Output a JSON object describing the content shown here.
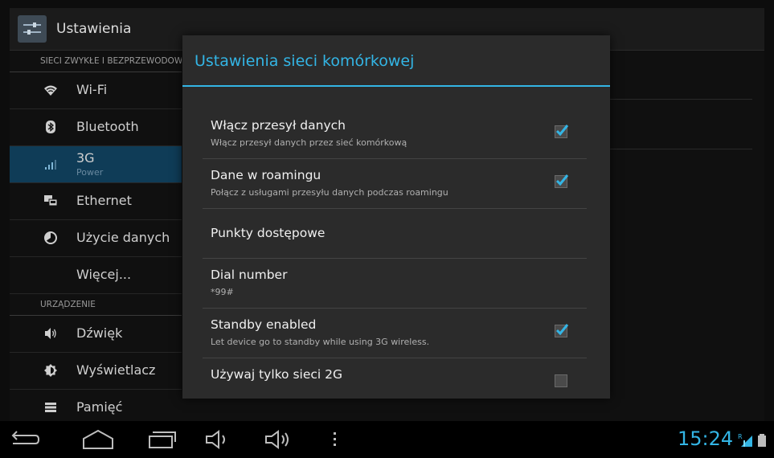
{
  "app_title": "Ustawienia",
  "left_menu": {
    "header_wireless": "SIECI ZWYKŁE I BEZPRZEWODOWE",
    "wifi": "Wi-Fi",
    "bluetooth": "Bluetooth",
    "threeg": {
      "label": "3G",
      "sub": "Power"
    },
    "ethernet": "Ethernet",
    "data_usage": "Użycie danych",
    "more": "Więcej...",
    "header_device": "URZĄDZENIE",
    "sound": "Dźwięk",
    "display": "Wyświetlacz",
    "storage": "Pamięć"
  },
  "dialog": {
    "title": "Ustawienia sieci komórkowej",
    "items": [
      {
        "title": "Włącz przesył danych",
        "summary": "Włącz przesył danych przez sieć komórkową",
        "checked": true
      },
      {
        "title": "Dane w roamingu",
        "summary": "Połącz z usługami przesyłu danych podczas roamingu",
        "checked": true
      },
      {
        "title": "Punkty dostępowe"
      },
      {
        "title": "Dial number",
        "summary": "*99#"
      },
      {
        "title": "Standby enabled",
        "summary": "Let device go to standby while using 3G wireless.",
        "checked": true
      },
      {
        "title": "Używaj tylko sieci 2G"
      }
    ]
  },
  "status": {
    "clock": "15:24"
  },
  "colors": {
    "accent": "#33b5e5",
    "selected": "#0f3c57"
  }
}
